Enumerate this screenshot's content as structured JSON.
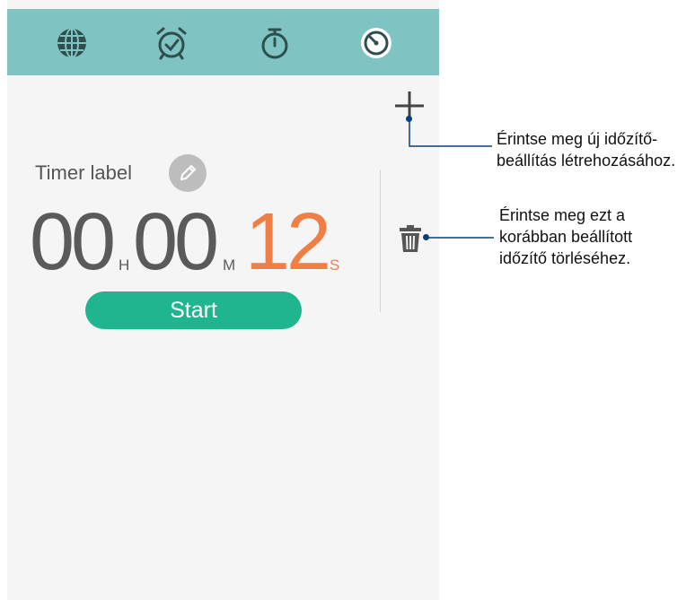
{
  "tabs": [
    {
      "name": "world-clock",
      "icon": "globe-icon"
    },
    {
      "name": "alarm",
      "icon": "alarm-clock-icon"
    },
    {
      "name": "stopwatch",
      "icon": "stopwatch-icon"
    },
    {
      "name": "timer",
      "icon": "timer-icon",
      "selected": true
    }
  ],
  "timer": {
    "label": "Timer label",
    "hours": "00",
    "hours_unit": "H",
    "minutes": "00",
    "minutes_unit": "M",
    "seconds": "12",
    "seconds_unit": "S",
    "start_label": "Start"
  },
  "callouts": {
    "add_line1": "Érintse meg új időzítő-",
    "add_line2": "beállítás létrehozásához.",
    "delete_line1": "Érintse meg ezt a",
    "delete_line2": "korábban beállított",
    "delete_line3": "időzítő törléséhez."
  },
  "colors": {
    "topbar": "#7fc4c2",
    "accent_seconds": "#ef7f45",
    "start_button": "#1fb58e",
    "callout_line": "#0a3f7c"
  }
}
